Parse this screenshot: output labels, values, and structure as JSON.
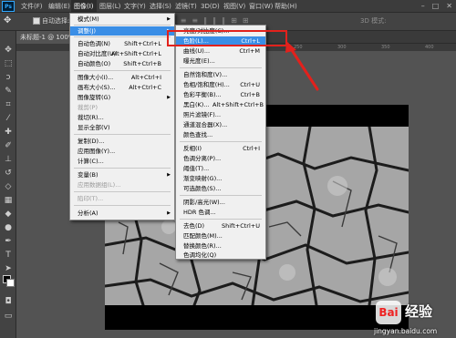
{
  "menubar": {
    "logo": "Ps",
    "items": [
      "文件(F)",
      "编辑(E)",
      "图像(I)",
      "图层(L)",
      "文字(Y)",
      "选择(S)",
      "滤镜(T)",
      "3D(D)",
      "视图(V)",
      "窗口(W)",
      "帮助(H)"
    ],
    "active_index": 2
  },
  "options": {
    "auto_select": "自动选择:",
    "mode_3d": "3D 模式:"
  },
  "document_tab": "未标题-1 @ 100%",
  "ruler_marks": [
    "0",
    "50",
    "100",
    "150",
    "200",
    "250",
    "300",
    "350",
    "400"
  ],
  "image_menu": {
    "items": [
      {
        "label": "模式(M)",
        "shortcut": "",
        "submenu": true,
        "disabled": false
      },
      {
        "label": "调整(J)",
        "shortcut": "",
        "submenu": true,
        "disabled": false,
        "highlight": true
      },
      {
        "label": "自动色调(N)",
        "shortcut": "Shift+Ctrl+L",
        "disabled": false
      },
      {
        "label": "自动对比度(U)",
        "shortcut": "Alt+Shift+Ctrl+L",
        "disabled": false
      },
      {
        "label": "自动颜色(O)",
        "shortcut": "Shift+Ctrl+B",
        "disabled": false
      },
      {
        "label": "图像大小(I)...",
        "shortcut": "Alt+Ctrl+I",
        "disabled": false
      },
      {
        "label": "画布大小(S)...",
        "shortcut": "Alt+Ctrl+C",
        "disabled": false
      },
      {
        "label": "图像旋转(G)",
        "shortcut": "",
        "submenu": true,
        "disabled": false
      },
      {
        "label": "裁剪(P)",
        "shortcut": "",
        "disabled": true
      },
      {
        "label": "裁切(R)...",
        "shortcut": "",
        "disabled": false
      },
      {
        "label": "显示全部(V)",
        "shortcut": "",
        "disabled": false
      },
      {
        "label": "复制(D)...",
        "shortcut": "",
        "disabled": false
      },
      {
        "label": "应用图像(Y)...",
        "shortcut": "",
        "disabled": false
      },
      {
        "label": "计算(C)...",
        "shortcut": "",
        "disabled": false
      },
      {
        "label": "变量(B)",
        "shortcut": "",
        "submenu": true,
        "disabled": false
      },
      {
        "label": "应用数据组(L)...",
        "shortcut": "",
        "disabled": true
      },
      {
        "label": "陷印(T)...",
        "shortcut": "",
        "disabled": true
      },
      {
        "label": "分析(A)",
        "shortcut": "",
        "submenu": true,
        "disabled": false
      }
    ]
  },
  "adjust_menu": {
    "items": [
      {
        "label": "亮度/对比度(C)...",
        "shortcut": ""
      },
      {
        "label": "色阶(L)...",
        "shortcut": "Ctrl+L",
        "highlight": true
      },
      {
        "label": "曲线(U)...",
        "shortcut": "Ctrl+M"
      },
      {
        "label": "曝光度(E)...",
        "shortcut": ""
      },
      {
        "label": "自然饱和度(V)...",
        "shortcut": ""
      },
      {
        "label": "色相/饱和度(H)...",
        "shortcut": "Ctrl+U"
      },
      {
        "label": "色彩平衡(B)...",
        "shortcut": "Ctrl+B"
      },
      {
        "label": "黑白(K)...",
        "shortcut": "Alt+Shift+Ctrl+B"
      },
      {
        "label": "照片滤镜(F)...",
        "shortcut": ""
      },
      {
        "label": "通道混合器(X)...",
        "shortcut": ""
      },
      {
        "label": "颜色查找...",
        "shortcut": ""
      },
      {
        "label": "反相(I)",
        "shortcut": "Ctrl+I"
      },
      {
        "label": "色调分离(P)...",
        "shortcut": ""
      },
      {
        "label": "阈值(T)...",
        "shortcut": ""
      },
      {
        "label": "渐变映射(G)...",
        "shortcut": ""
      },
      {
        "label": "可选颜色(S)...",
        "shortcut": ""
      },
      {
        "label": "阴影/高光(W)...",
        "shortcut": ""
      },
      {
        "label": "HDR 色调...",
        "shortcut": ""
      },
      {
        "label": "去色(D)",
        "shortcut": "Shift+Ctrl+U"
      },
      {
        "label": "匹配颜色(M)...",
        "shortcut": ""
      },
      {
        "label": "替换颜色(R)...",
        "shortcut": ""
      },
      {
        "label": "色调均化(Q)",
        "shortcut": ""
      }
    ]
  },
  "watermark": {
    "logo": "Bai",
    "title": "经验",
    "url": "jingyan.baidu.com"
  },
  "colors": {
    "highlight": "#3a8ee6",
    "annotation": "#e2211c",
    "canvas": "#000000"
  }
}
